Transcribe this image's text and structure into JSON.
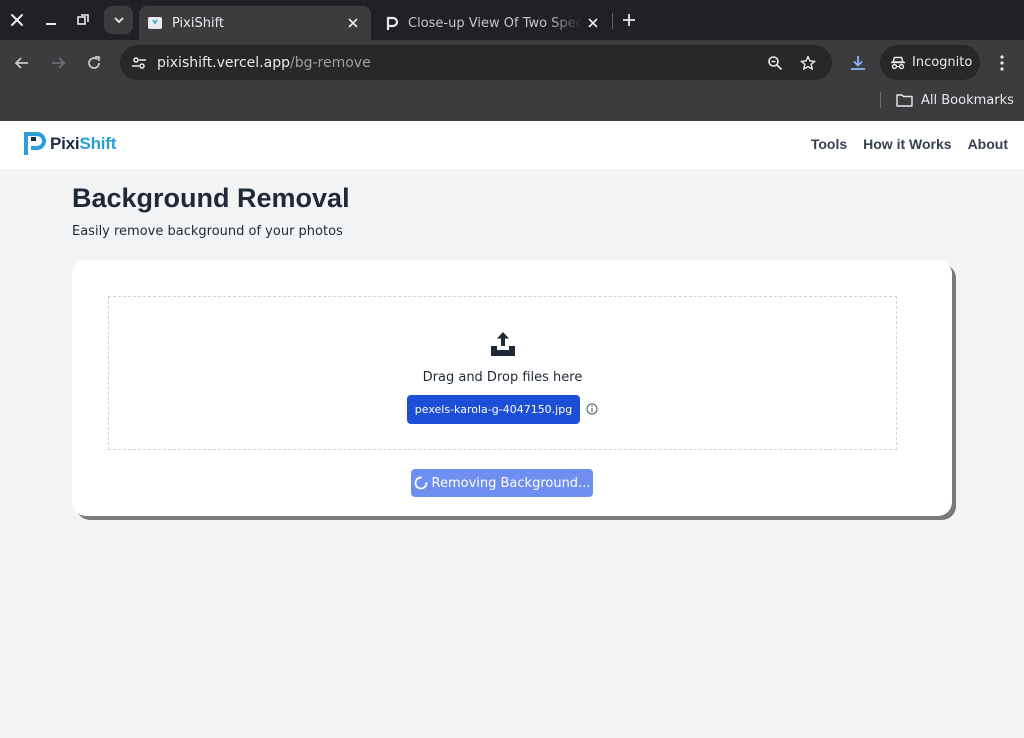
{
  "browser": {
    "tabs": [
      {
        "title": "PixiShift",
        "favicon": "pixishift-favicon",
        "active": true
      },
      {
        "title": "Close-up View Of Two Species",
        "favicon": "pexels-favicon",
        "active": false
      }
    ],
    "address": {
      "domain": "pixishift.vercel.app",
      "path": "/bg-remove"
    },
    "profile_label": "Incognito",
    "bookmarks_label": "All Bookmarks"
  },
  "site": {
    "logo": {
      "part1": "Pixi",
      "part2": "Shift"
    },
    "nav": [
      "Tools",
      "How it Works",
      "About"
    ]
  },
  "main": {
    "title": "Background Removal",
    "subtitle": "Easily remove background of your photos",
    "dropzone_text": "Drag and Drop files here",
    "file_name": "pexels-karola-g-4047150.jpg",
    "action_label": "Removing Background..."
  },
  "colors": {
    "browser_frame": "#202124",
    "toolbar": "#3c3c3f",
    "primary_button": "#1d4ed8",
    "disabled_button": "#6f8ff0",
    "logo_dark": "#1f2a44",
    "logo_accent": "#2a9fd6",
    "page_bg": "#f3f4f6"
  }
}
